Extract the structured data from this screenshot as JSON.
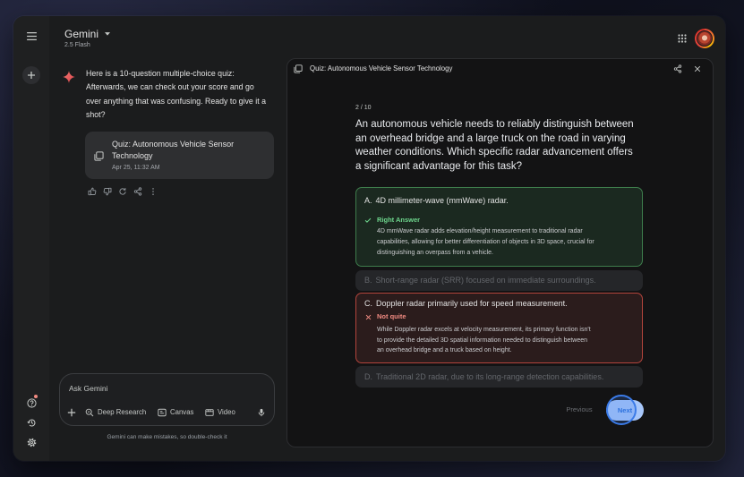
{
  "header": {
    "title": "Gemini",
    "model": "2.5 Flash",
    "dropdown_icon": "caret-down-icon",
    "apps_icon": "apps-grid-icon",
    "avatar_icon": "account-avatar"
  },
  "sidebar": {
    "menu_icon": "menu-icon",
    "new_chat_icon": "plus-icon",
    "bottom_icons": [
      "help-icon",
      "activity-icon",
      "settings-icon"
    ],
    "help_has_notification": true
  },
  "chat": {
    "response_icon": "gemini-sparkle-icon",
    "message_lines": [
      "Here is a 10-question multiple-choice quiz:",
      "Afterwards, we can check out your score and go",
      "over anything that was confusing. Ready to give it a",
      "shot?"
    ],
    "artifact_card": {
      "icon": "quiz-stack-icon",
      "title_lines": [
        "Quiz: Autonomous Vehicle Sensor",
        "Technology"
      ],
      "timestamp": "Apr 25, 11:32 AM"
    },
    "response_actions": [
      "thumbs-up-icon",
      "thumbs-down-icon",
      "regenerate-icon",
      "share-icon",
      "more-options-icon"
    ]
  },
  "composer": {
    "placeholder": "Ask Gemini",
    "value": "",
    "add_icon": "plus-icon",
    "tools": [
      {
        "label": "Deep Research",
        "icon": "deep-research-icon"
      },
      {
        "label": "Canvas",
        "icon": "canvas-icon"
      },
      {
        "label": "Video",
        "icon": "video-icon"
      }
    ],
    "mic_icon": "microphone-icon",
    "disclaimer": "Gemini can make mistakes, so double-check it"
  },
  "quiz": {
    "title": "Quiz: Autonomous Vehicle Sensor Technology",
    "title_icon": "quiz-stack-icon",
    "header_actions": [
      "share-icon",
      "close-icon"
    ],
    "progress": "2 / 10",
    "question_lines": [
      "An autonomous vehicle needs to reliably distinguish between",
      "an overhead bridge and a large truck on the road in varying",
      "weather conditions. Which specific radar advancement offers",
      "a significant advantage for this task?"
    ],
    "options": [
      {
        "letter": "A.",
        "text": "4D millimeter-wave (mmWave) radar.",
        "state": "correct",
        "feedback_icon": "check-icon",
        "feedback_label": "Right Answer",
        "feedback_lines": [
          "4D mmWave radar adds elevation/height measurement to traditional radar",
          "capabilities, allowing for better differentiation of objects in 3D space, crucial for",
          "distinguishing an overpass from a vehicle."
        ]
      },
      {
        "letter": "B.",
        "text": "Short-range radar (SRR) focused on immediate surroundings.",
        "state": "unselected"
      },
      {
        "letter": "C.",
        "text": "Doppler radar primarily used for speed measurement.",
        "state": "incorrect",
        "feedback_icon": "close-icon",
        "feedback_label": "Not quite",
        "feedback_lines": [
          "While Doppler radar excels at velocity measurement, its primary function isn't",
          "to provide the detailed 3D spatial information needed to distinguish between",
          "an overhead bridge and a truck based on height."
        ]
      },
      {
        "letter": "D.",
        "text": "Traditional 2D radar, due to its long-range detection capabilities.",
        "state": "unselected"
      }
    ],
    "navigation": {
      "previous_label": "Previous",
      "next_label": "Next"
    }
  },
  "colors": {
    "accent": "#2a6fdb",
    "accent_light": "#a8c7fa",
    "correct": "#6dd58c",
    "correct_border": "#3e7d4c",
    "incorrect": "#f28b82",
    "incorrect_border": "#b3443c",
    "notify": "#f28b82",
    "sparkle": "#e8595b"
  }
}
